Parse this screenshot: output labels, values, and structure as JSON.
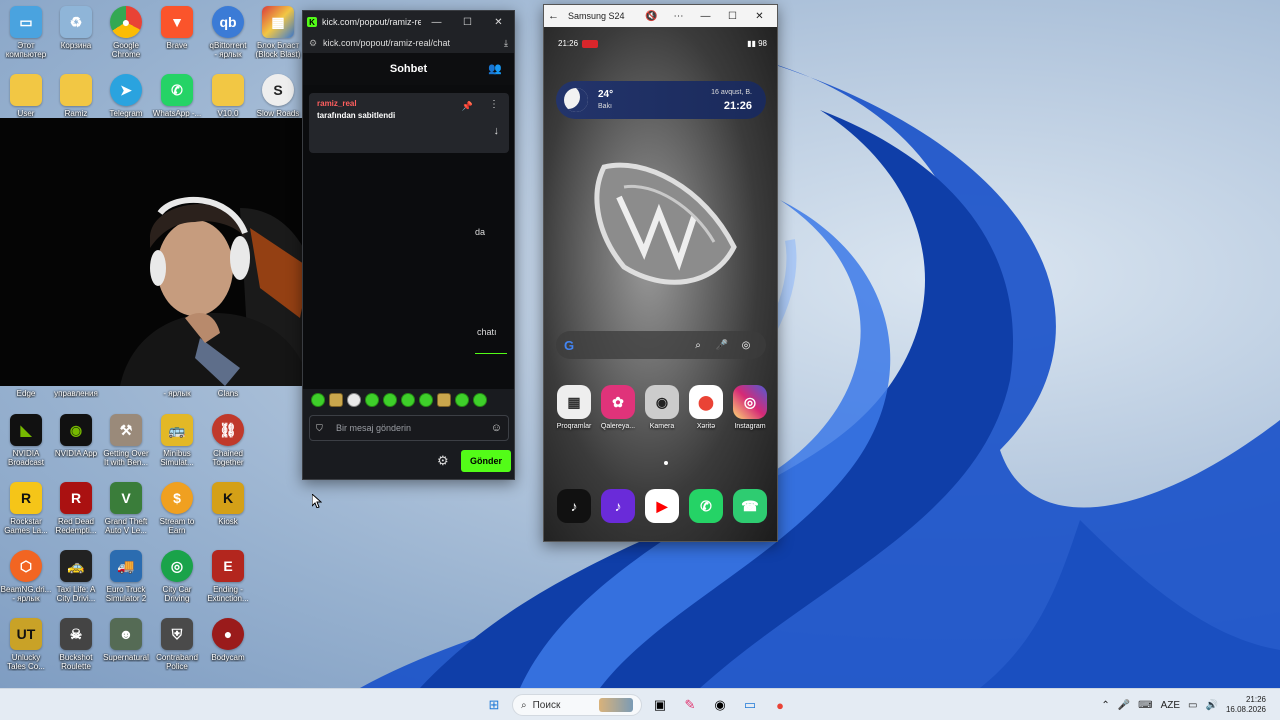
{
  "desktop": {
    "icons": [
      {
        "label": "Этот\nкомпьютер",
        "icon": "this-pc-icon",
        "color": "#4aa3df"
      },
      {
        "label": "Корзина",
        "icon": "recycle-bin-icon",
        "color": "#8fb5d8"
      },
      {
        "label": "Google\nChrome",
        "icon": "chrome-icon",
        "color": "#e94235"
      },
      {
        "label": "Brave",
        "icon": "brave-icon",
        "color": "#fb542b"
      },
      {
        "label": "qBittorrent\n- ярлык",
        "icon": "qbittorrent-icon",
        "color": "#3b7bd6"
      },
      {
        "label": "Блок Бласт\n(Block Blast)",
        "icon": "block-blast-icon",
        "color": "#d93b3b"
      },
      {
        "label": "User",
        "icon": "folder-icon",
        "color": "#f2c744"
      },
      {
        "label": "Ramiz",
        "icon": "folder-icon",
        "color": "#f2c744"
      },
      {
        "label": "Telegram",
        "icon": "telegram-icon",
        "color": "#2aa3df"
      },
      {
        "label": "WhatsApp -...",
        "icon": "whatsapp-icon",
        "color": "#25d366"
      },
      {
        "label": "V10.0",
        "icon": "folder-icon",
        "color": "#f2c744"
      },
      {
        "label": "Slow Roads",
        "icon": "slow-roads-icon",
        "color": "#eeeeee"
      },
      {
        "label": "Edge",
        "icon": "edge-icon",
        "color": "#1a8fd6"
      },
      {
        "label": "управления",
        "icon": "control-panel-icon",
        "color": "#5a7fb0"
      },
      {
        "label": "...",
        "icon": "app-icon",
        "color": "#777777"
      },
      {
        "label": "- ярлык",
        "icon": "app-icon",
        "color": "#777777"
      },
      {
        "label": "Clans",
        "icon": "clans-icon",
        "color": "#8a6d3b"
      },
      {
        "label": "NVIDIA\nBroadcast",
        "icon": "nvidia-broadcast-icon",
        "color": "#76b900"
      },
      {
        "label": "NVIDIA App",
        "icon": "nvidia-app-icon",
        "color": "#76b900"
      },
      {
        "label": "Getting Over\nIt with Ben...",
        "icon": "getting-over-it-icon",
        "color": "#9a8a7a"
      },
      {
        "label": "Minibus\nSimulat...",
        "icon": "minibus-icon",
        "color": "#e3b826"
      },
      {
        "label": "Chained\nTogether",
        "icon": "chained-together-icon",
        "color": "#c0392b"
      },
      {
        "label": "Rockstar\nGames La...",
        "icon": "rockstar-icon",
        "color": "#f5c518"
      },
      {
        "label": "Red Dead\nRedempti...",
        "icon": "red-dead-icon",
        "color": "#a11"
      },
      {
        "label": "Grand Theft\nAuto V Le...",
        "icon": "gta-icon",
        "color": "#3a7d3a"
      },
      {
        "label": "Stream to\nEarn",
        "icon": "stream-to-earn-icon",
        "color": "#f0a020"
      },
      {
        "label": "Kiosk",
        "icon": "kiosk-icon",
        "color": "#d4a017"
      },
      {
        "label": "BeamNG.dri...\n- ярлык",
        "icon": "beamng-icon",
        "color": "#f26522"
      },
      {
        "label": "Taxi Life: A\nCity Drivi...",
        "icon": "taxi-life-icon",
        "color": "#222222"
      },
      {
        "label": "Euro Truck\nSimulator 2",
        "icon": "euro-truck-icon",
        "color": "#2b6cb0"
      },
      {
        "label": "City Car\nDriving",
        "icon": "city-car-icon",
        "color": "#1aa34a"
      },
      {
        "label": "Ending -\nExtinction...",
        "icon": "ending-icon",
        "color": "#b3261e"
      },
      {
        "label": "Unlucky\nTales Co...",
        "icon": "unlucky-tales-icon",
        "color": "#c9a227"
      },
      {
        "label": "Buckshot\nRoulette",
        "icon": "buckshot-icon",
        "color": "#444444"
      },
      {
        "label": "Supernatural",
        "icon": "supernatural-icon",
        "color": "#556b55"
      },
      {
        "label": "Contraband\nPolice",
        "icon": "contraband-icon",
        "color": "#4a4a4a"
      },
      {
        "label": "Bodycam",
        "icon": "bodycam-icon",
        "color": "#9a1b1b"
      }
    ]
  },
  "chat_window": {
    "title": "kick.com/popout/ramiz-real...",
    "url": "kick.com/popout/ramiz-real/chat",
    "header": "Sohbet",
    "pinned": {
      "username": "ramiz_real",
      "text": "tarafından sabitlendi"
    },
    "fragments": [
      "da",
      "chatı"
    ],
    "input_placeholder": "Bir mesaj gönderin",
    "send_label": "Gönder",
    "accent": "#53fc18"
  },
  "phone_window": {
    "title": "Samsung S24",
    "status_time": "21:26",
    "battery": "98",
    "weather": {
      "temp": "24°",
      "city": "Bakı",
      "date": "16 avqust, B.",
      "time": "21:26"
    },
    "apps": [
      {
        "label": "Proqramlar",
        "icon": "apps-grid-icon",
        "color": "#eeeeee"
      },
      {
        "label": "Qalereya...",
        "icon": "gallery-icon",
        "color": "#e0337a"
      },
      {
        "label": "Kamera",
        "icon": "camera-icon",
        "color": "#cccccc"
      },
      {
        "label": "Xəritə",
        "icon": "maps-icon",
        "color": "#ffffff"
      },
      {
        "label": "Instagram",
        "icon": "instagram-icon",
        "color": "#d6249f"
      }
    ],
    "dock": [
      {
        "icon": "tiktok-icon",
        "color": "#111111"
      },
      {
        "icon": "tiktok-alt-icon",
        "color": "#6a2bd9"
      },
      {
        "icon": "youtube-icon",
        "color": "#ff0000"
      },
      {
        "icon": "whatsapp-icon",
        "color": "#25d366"
      },
      {
        "icon": "phone-icon",
        "color": "#2ecc71"
      }
    ]
  },
  "taskbar": {
    "search_placeholder": "Поиск",
    "language": "AZE",
    "time": "21:26",
    "date": "16.08.2026"
  }
}
